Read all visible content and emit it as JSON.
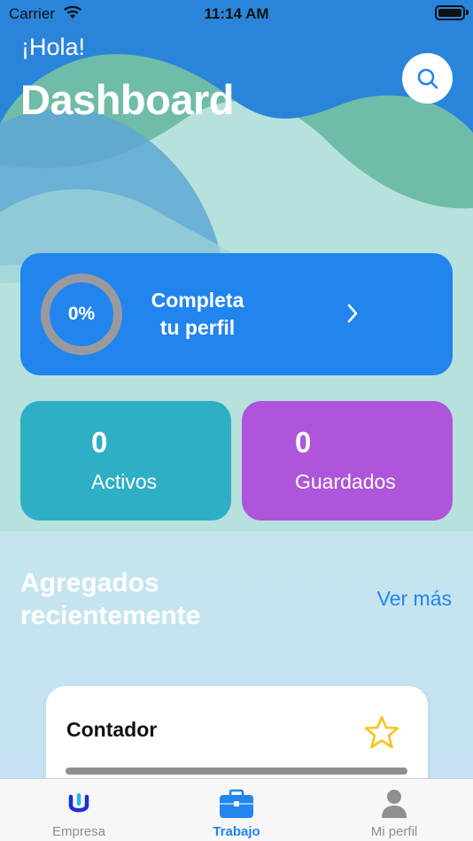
{
  "status_bar": {
    "carrier": "Carrier",
    "time": "11:14 AM"
  },
  "header": {
    "greeting": "¡Hola!",
    "title": "Dashboard",
    "search_icon": "search-icon"
  },
  "profile_card": {
    "percent_label": "0%",
    "progress": 0,
    "line1": "Completa",
    "line2": "tu perfil",
    "chevron_icon": "chevron-right-icon"
  },
  "stats": {
    "activos": {
      "value": "0",
      "label": "Activos"
    },
    "guardados": {
      "value": "0",
      "label": "Guardados"
    }
  },
  "recent": {
    "title_line1": "Agregados",
    "title_line2": "recientemente",
    "see_more": "Ver más",
    "items": [
      {
        "title": "Contador",
        "icon": "star-icon"
      }
    ]
  },
  "tabs": [
    {
      "label": "Empresa",
      "icon": "company-logo-icon",
      "active": false
    },
    {
      "label": "Trabajo",
      "icon": "briefcase-icon",
      "active": true
    },
    {
      "label": "Mi perfil",
      "icon": "person-icon",
      "active": false
    }
  ],
  "colors": {
    "primary": "#2285ee",
    "activos": "#2eafc6",
    "guardados": "#ae55db",
    "star": "#f5c518",
    "inactive_tab": "#8e8e93"
  }
}
